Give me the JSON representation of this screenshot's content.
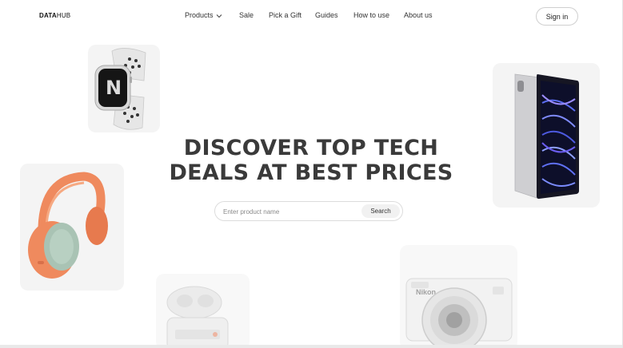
{
  "header": {
    "logo_bold": "DATA",
    "logo_light": "HUB",
    "nav": [
      {
        "label": "Products",
        "has_dropdown": true
      },
      {
        "label": "Sale"
      },
      {
        "label": "Pick a Gift"
      },
      {
        "label": "Guides"
      },
      {
        "label": "How to use"
      },
      {
        "label": "About us"
      }
    ],
    "signin_label": "Sign in"
  },
  "hero": {
    "title_line1": "DISCOVER TOP TECH",
    "title_line2": "DEALS AT BEST PRICES"
  },
  "search": {
    "placeholder": "Enter product name",
    "button_label": "Search"
  },
  "products": [
    {
      "name": "smartwatch",
      "icon": "smartwatch-icon"
    },
    {
      "name": "tablet",
      "icon": "tablet-icon"
    },
    {
      "name": "headphones",
      "icon": "headphones-icon"
    },
    {
      "name": "earbuds-case",
      "icon": "earbuds-icon",
      "label": "Nikon"
    },
    {
      "name": "camera",
      "icon": "camera-icon",
      "brand": "Nikon"
    }
  ],
  "colors": {
    "headphone_orange": "#ef8a5e",
    "headphone_mint": "#a9c3b4",
    "card_bg": "#f4f4f4",
    "title_text": "#3a3a3a"
  }
}
